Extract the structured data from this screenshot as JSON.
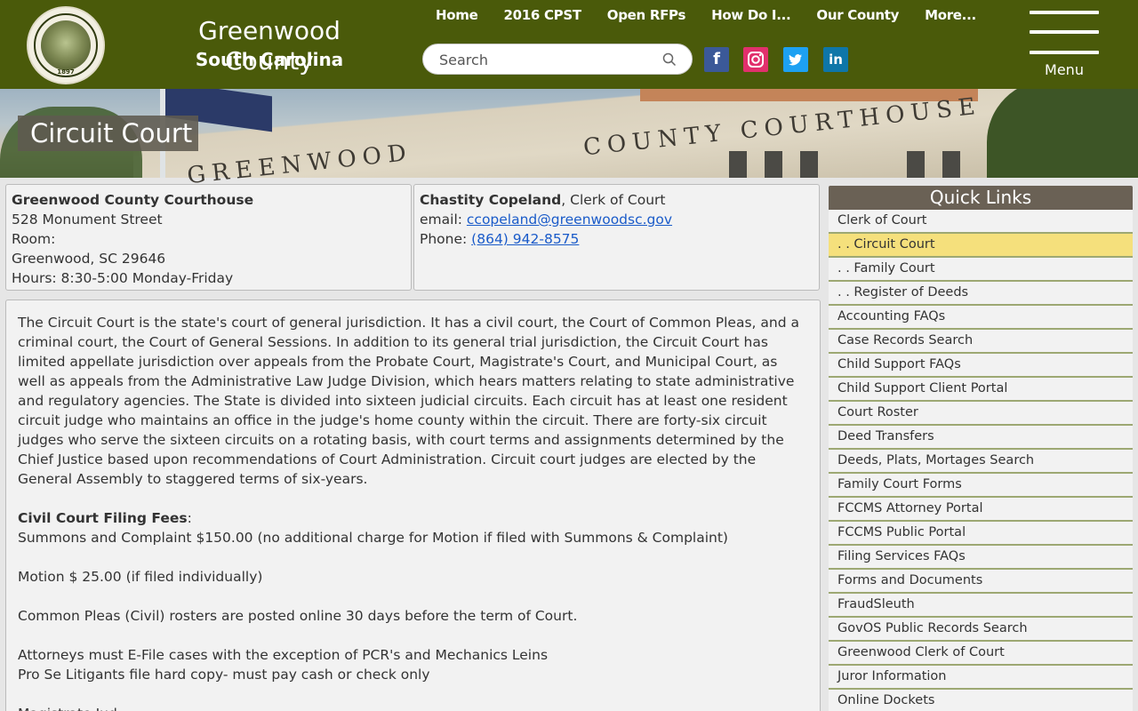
{
  "header": {
    "seal_text": "1897",
    "site_title": "Greenwood County",
    "site_subtitle": "South Carolina",
    "nav": [
      "Home",
      "2016 CPST",
      "Open RFPs",
      "How Do I...",
      "Our County",
      "More..."
    ],
    "search_placeholder": "Search",
    "menu_label": "Menu",
    "social": [
      "facebook-icon",
      "instagram-icon",
      "twitter-icon",
      "linkedin-icon"
    ]
  },
  "hero": {
    "page_title": "Circuit Court",
    "engraving_1": "GREENWOOD",
    "engraving_2": "COUNTY COURTHOUSE"
  },
  "address": {
    "name": "Greenwood County Courthouse",
    "street": "528 Monument Street",
    "room": "Room:",
    "city": "Greenwood, SC 29646",
    "hours": "Hours: 8:30-5:00 Monday-Friday"
  },
  "contact": {
    "person": "Chastity Copeland",
    "role": ", Clerk of Court",
    "email_label": "email: ",
    "email": "ccopeland@greenwoodsc.gov",
    "phone_label": "Phone: ",
    "phone": "(864) 942-8575"
  },
  "content": {
    "intro": "The Circuit Court is the state's court of general jurisdiction. It has a civil court, the Court of Common Pleas, and a criminal court, the Court of General Sessions. In addition to its general trial jurisdiction, the Circuit Court has limited appellate jurisdiction over appeals from the Probate Court, Magistrate's Court, and Municipal Court, as well as appeals from the Administrative Law Judge Division, which hears matters relating to state administrative and regulatory agencies. The State is divided into sixteen judicial circuits. Each circuit has at least one resident circuit judge who maintains an office in the judge's home county within the circuit. There are forty-six circuit judges who serve the sixteen circuits on a rotating basis, with court terms and assignments determined by the Chief Justice based upon recommendations of Court Administration. Circuit court judges are elected by the General Assembly to staggered terms of six-years.",
    "fees_heading": "Civil Court Filing Fees",
    "fees_colon": ":",
    "fee_1": "Summons and Complaint $150.00 (no additional charge for Motion if filed with Summons & Complaint)",
    "fee_2": "Motion $ 25.00 (if filed individually)",
    "rosters": "Common Pleas (Civil) rosters are posted online 30 days before the term of Court.",
    "efile": "Attorneys must E-File cases with the exception of PCR's and Mechanics Leins",
    "prose": "Pro Se Litigants file hard copy- must pay cash or check only",
    "magistrate": "Magistrate Jud..."
  },
  "quick_links": {
    "title": "Quick Links",
    "items": [
      "Clerk of Court",
      ". . Circuit Court",
      ". . Family Court",
      ". . Register of Deeds",
      "Accounting FAQs",
      "Case Records Search",
      "Child Support FAQs",
      "Child Support Client Portal",
      "Court Roster",
      "Deed Transfers",
      "Deeds, Plats, Mortages Search",
      "Family Court Forms",
      "FCCMS Attorney Portal",
      "FCCMS Public Portal",
      "Filing Services FAQs",
      "Forms and Documents",
      "FraudSleuth",
      "GovOS Public Records Search",
      "Greenwood Clerk of Court",
      "Juror Information",
      "Online Dockets"
    ],
    "active_index": 1
  },
  "colors": {
    "header_bg": "#4a5a0a",
    "quick_links_title_bg": "#6a6155",
    "active_link_bg": "#f5e07c",
    "link_color": "#1a5bc9"
  }
}
